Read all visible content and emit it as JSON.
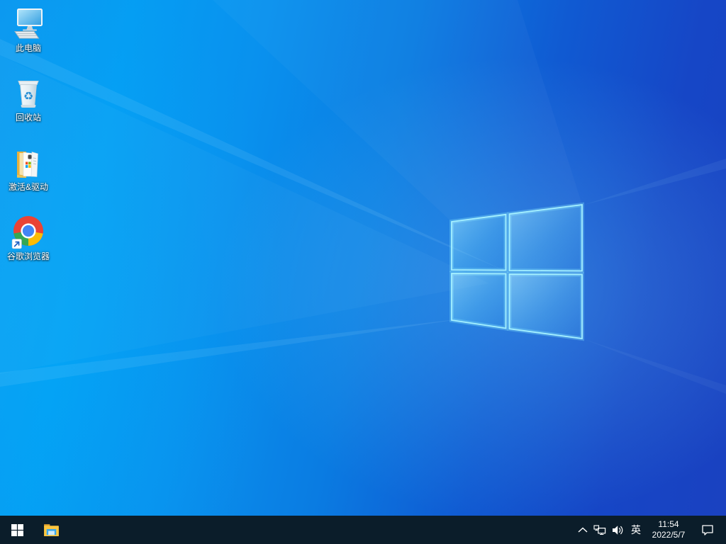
{
  "wallpaper": {
    "gradient_left": "#059df3",
    "gradient_right": "#1a41c0",
    "logo_edge_color": "#8feeff",
    "logo_fill_color": "#5ecbf9",
    "taskbar_color": "#0b1d2a"
  },
  "desktop_icons": [
    {
      "name": "this-pc",
      "label": "此电脑"
    },
    {
      "name": "recycle-bin",
      "label": "回收站"
    },
    {
      "name": "activation-drivers-folder",
      "label": "激活&驱动"
    },
    {
      "name": "google-chrome",
      "label": "谷歌浏览器"
    }
  ],
  "taskbar": {
    "icons": {
      "start": "start-windows-icon",
      "file_explorer": "file-explorer-icon",
      "hidden_icons": "chevron-up-icon",
      "network": "ethernet-network-icon",
      "volume": "speaker-volume-icon",
      "action_center": "action-center-icon"
    },
    "tray": {
      "ime_indicator": "英",
      "time": "11:54",
      "date": "2022/5/7"
    }
  }
}
